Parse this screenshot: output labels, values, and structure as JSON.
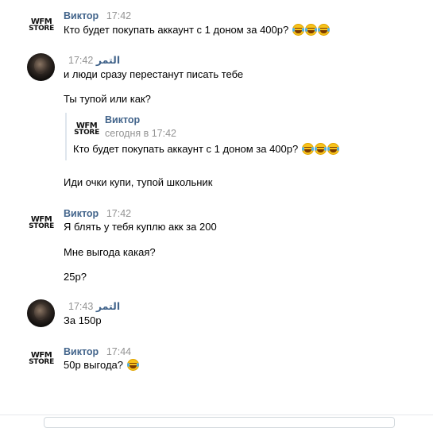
{
  "messages": [
    {
      "author": "Виктор",
      "time": "17:42",
      "avatar": "wfm-store-logo",
      "lines": [
        "Кто будет покупать аккаунт с 1 доном за 400р?"
      ],
      "emoji_count": 3,
      "emoji": "face-with-tears-of-joy-icon"
    },
    {
      "author": "التمر",
      "time": "17:42",
      "avatar": "user-photo",
      "lines": [
        "и люди сразу перестанут писать тебе",
        "Ты тупой или как?",
        "Иди очки купи, тупой школьник"
      ],
      "quote": {
        "author": "Виктор",
        "time": "сегодня в 17:42",
        "text": "Кто будет покупать аккаунт с 1 доном за 400р?",
        "emoji_count": 3
      }
    },
    {
      "author": "Виктор",
      "time": "17:42",
      "avatar": "wfm-store-logo",
      "lines": [
        "Я блять у тебя куплю акк за 200",
        "Мне выгода какая?",
        "25р?"
      ]
    },
    {
      "author": "التمر",
      "time": "17:43",
      "avatar": "user-photo",
      "lines": [
        "За 150р"
      ]
    },
    {
      "author": "Виктор",
      "time": "17:44",
      "avatar": "wfm-store-logo",
      "lines": [
        "50р выгода?"
      ],
      "emoji_count": 1
    }
  ],
  "logo": {
    "line1": "WFM",
    "line2": "STORE"
  },
  "colors": {
    "author": "#42648b",
    "time": "#939393",
    "text": "#000000",
    "quote_border": "#dfe6ed"
  }
}
